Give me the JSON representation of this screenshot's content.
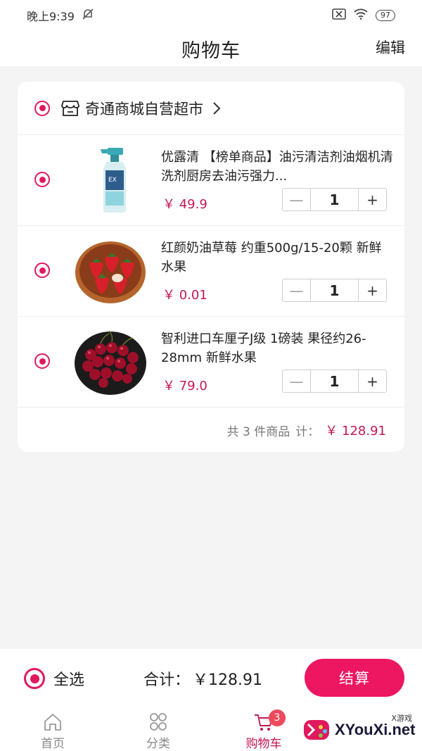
{
  "status_bar": {
    "time": "晚上9:39",
    "battery": "97"
  },
  "nav": {
    "title": "购物车",
    "edit_label": "编辑"
  },
  "store": {
    "name": "奇通商城自营超市"
  },
  "items": [
    {
      "title": "优露清 【榜单商品】油污清洁剂油烟机清洗剂厨房去油污强力...",
      "price": "￥ 49.9",
      "quantity": "1",
      "image": "cleaner-spray-bottle"
    },
    {
      "title": "红颜奶油草莓 约重500g/15-20颗 新鲜水果",
      "price": "￥ 0.01",
      "quantity": "1",
      "image": "strawberry-bowl"
    },
    {
      "title": "智利进口车厘子J级 1磅装 果径约26-28mm 新鲜水果",
      "price": "￥ 79.0",
      "quantity": "1",
      "image": "cherry-plate"
    }
  ],
  "summary": {
    "count_text": "共 3 件商品",
    "total_label": "计：",
    "total_value": "￥ 128.91"
  },
  "checkout": {
    "select_all_label": "全选",
    "sum_label": "合计：",
    "sum_value": "￥128.91",
    "button_label": "结算"
  },
  "tabs": [
    {
      "label": "首页",
      "icon": "home-icon"
    },
    {
      "label": "分类",
      "icon": "category-icon"
    },
    {
      "label": "购物车",
      "icon": "cart-icon",
      "badge": "3",
      "active": true
    }
  ],
  "watermark": {
    "text": "XYouXi.net",
    "small_text": "X游戏"
  },
  "colors": {
    "accent": "#ed1660",
    "price": "#c21850",
    "background": "#f4f4f4"
  }
}
